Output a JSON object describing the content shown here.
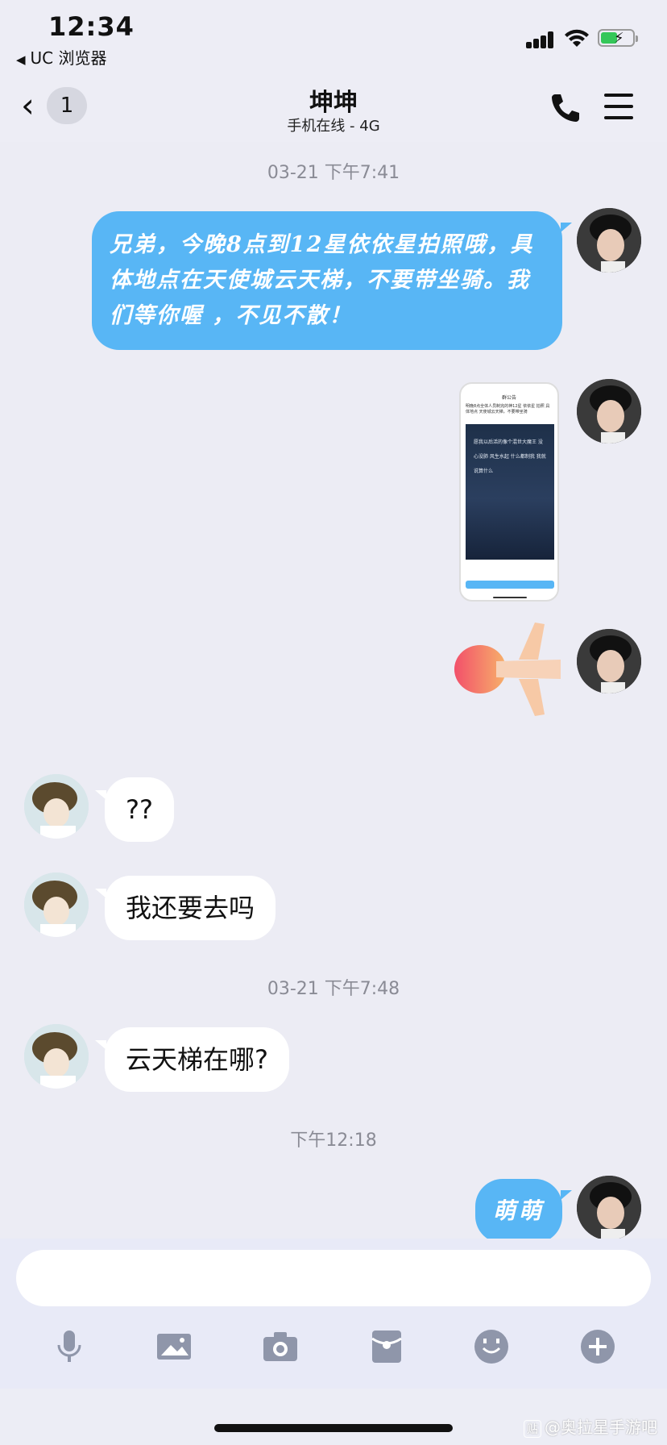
{
  "status_bar": {
    "time": "12:34",
    "back_app": "UC 浏览器"
  },
  "nav": {
    "unread_count": "1",
    "title": "坤坤",
    "subtitle": "手机在线 - 4G"
  },
  "messages": {
    "ts1": "03-21 下午7:41",
    "m1": "兄弟，今晚8点到12星依依星拍照哦，具体地点在天使城云天梯，不要带坐骑。我们等你喔 ，不见不散！",
    "shot_header": "群公告",
    "shot_text": "明晚8点全体人员制完的神12星 依依星 拍照 具体地点 天使城云天梯，不要带坐骑",
    "shot_quote": "愿我以后活的像个混世大魔王 没心没肺 风生水起 什么都制我 我就说算什么",
    "m_q": "??",
    "m_go": "我还要去吗",
    "ts2": "03-21 下午7:48",
    "m_where": "云天梯在哪?",
    "ts3": "下午12:18",
    "m_last": "萌萌"
  },
  "composer": {
    "placeholder": ""
  },
  "watermark": {
    "badge": "贴",
    "text": "@奥拉星手游吧"
  }
}
